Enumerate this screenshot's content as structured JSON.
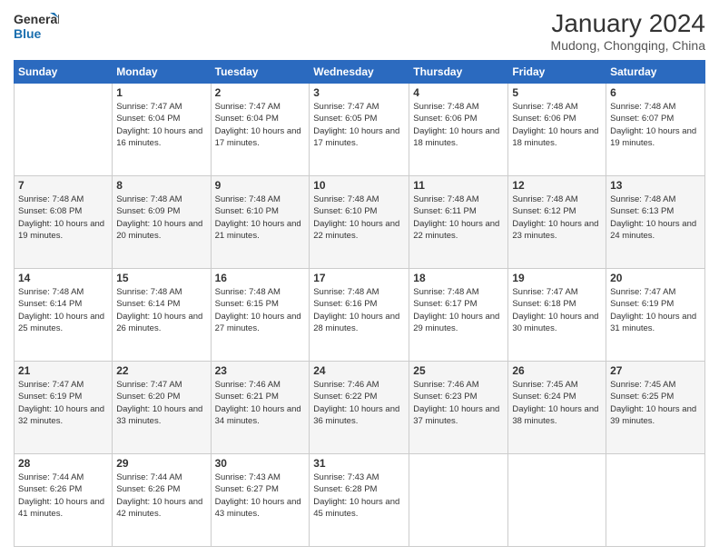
{
  "header": {
    "logo": {
      "line1": "General",
      "line2": "Blue"
    },
    "title": "January 2024",
    "location": "Mudong, Chongqing, China"
  },
  "columns": [
    "Sunday",
    "Monday",
    "Tuesday",
    "Wednesday",
    "Thursday",
    "Friday",
    "Saturday"
  ],
  "weeks": [
    [
      {
        "day": "",
        "sunrise": "",
        "sunset": "",
        "daylight": ""
      },
      {
        "day": "1",
        "sunrise": "Sunrise: 7:47 AM",
        "sunset": "Sunset: 6:04 PM",
        "daylight": "Daylight: 10 hours and 16 minutes."
      },
      {
        "day": "2",
        "sunrise": "Sunrise: 7:47 AM",
        "sunset": "Sunset: 6:04 PM",
        "daylight": "Daylight: 10 hours and 17 minutes."
      },
      {
        "day": "3",
        "sunrise": "Sunrise: 7:47 AM",
        "sunset": "Sunset: 6:05 PM",
        "daylight": "Daylight: 10 hours and 17 minutes."
      },
      {
        "day": "4",
        "sunrise": "Sunrise: 7:48 AM",
        "sunset": "Sunset: 6:06 PM",
        "daylight": "Daylight: 10 hours and 18 minutes."
      },
      {
        "day": "5",
        "sunrise": "Sunrise: 7:48 AM",
        "sunset": "Sunset: 6:06 PM",
        "daylight": "Daylight: 10 hours and 18 minutes."
      },
      {
        "day": "6",
        "sunrise": "Sunrise: 7:48 AM",
        "sunset": "Sunset: 6:07 PM",
        "daylight": "Daylight: 10 hours and 19 minutes."
      }
    ],
    [
      {
        "day": "7",
        "sunrise": "Sunrise: 7:48 AM",
        "sunset": "Sunset: 6:08 PM",
        "daylight": "Daylight: 10 hours and 19 minutes."
      },
      {
        "day": "8",
        "sunrise": "Sunrise: 7:48 AM",
        "sunset": "Sunset: 6:09 PM",
        "daylight": "Daylight: 10 hours and 20 minutes."
      },
      {
        "day": "9",
        "sunrise": "Sunrise: 7:48 AM",
        "sunset": "Sunset: 6:10 PM",
        "daylight": "Daylight: 10 hours and 21 minutes."
      },
      {
        "day": "10",
        "sunrise": "Sunrise: 7:48 AM",
        "sunset": "Sunset: 6:10 PM",
        "daylight": "Daylight: 10 hours and 22 minutes."
      },
      {
        "day": "11",
        "sunrise": "Sunrise: 7:48 AM",
        "sunset": "Sunset: 6:11 PM",
        "daylight": "Daylight: 10 hours and 22 minutes."
      },
      {
        "day": "12",
        "sunrise": "Sunrise: 7:48 AM",
        "sunset": "Sunset: 6:12 PM",
        "daylight": "Daylight: 10 hours and 23 minutes."
      },
      {
        "day": "13",
        "sunrise": "Sunrise: 7:48 AM",
        "sunset": "Sunset: 6:13 PM",
        "daylight": "Daylight: 10 hours and 24 minutes."
      }
    ],
    [
      {
        "day": "14",
        "sunrise": "Sunrise: 7:48 AM",
        "sunset": "Sunset: 6:14 PM",
        "daylight": "Daylight: 10 hours and 25 minutes."
      },
      {
        "day": "15",
        "sunrise": "Sunrise: 7:48 AM",
        "sunset": "Sunset: 6:14 PM",
        "daylight": "Daylight: 10 hours and 26 minutes."
      },
      {
        "day": "16",
        "sunrise": "Sunrise: 7:48 AM",
        "sunset": "Sunset: 6:15 PM",
        "daylight": "Daylight: 10 hours and 27 minutes."
      },
      {
        "day": "17",
        "sunrise": "Sunrise: 7:48 AM",
        "sunset": "Sunset: 6:16 PM",
        "daylight": "Daylight: 10 hours and 28 minutes."
      },
      {
        "day": "18",
        "sunrise": "Sunrise: 7:48 AM",
        "sunset": "Sunset: 6:17 PM",
        "daylight": "Daylight: 10 hours and 29 minutes."
      },
      {
        "day": "19",
        "sunrise": "Sunrise: 7:47 AM",
        "sunset": "Sunset: 6:18 PM",
        "daylight": "Daylight: 10 hours and 30 minutes."
      },
      {
        "day": "20",
        "sunrise": "Sunrise: 7:47 AM",
        "sunset": "Sunset: 6:19 PM",
        "daylight": "Daylight: 10 hours and 31 minutes."
      }
    ],
    [
      {
        "day": "21",
        "sunrise": "Sunrise: 7:47 AM",
        "sunset": "Sunset: 6:19 PM",
        "daylight": "Daylight: 10 hours and 32 minutes."
      },
      {
        "day": "22",
        "sunrise": "Sunrise: 7:47 AM",
        "sunset": "Sunset: 6:20 PM",
        "daylight": "Daylight: 10 hours and 33 minutes."
      },
      {
        "day": "23",
        "sunrise": "Sunrise: 7:46 AM",
        "sunset": "Sunset: 6:21 PM",
        "daylight": "Daylight: 10 hours and 34 minutes."
      },
      {
        "day": "24",
        "sunrise": "Sunrise: 7:46 AM",
        "sunset": "Sunset: 6:22 PM",
        "daylight": "Daylight: 10 hours and 36 minutes."
      },
      {
        "day": "25",
        "sunrise": "Sunrise: 7:46 AM",
        "sunset": "Sunset: 6:23 PM",
        "daylight": "Daylight: 10 hours and 37 minutes."
      },
      {
        "day": "26",
        "sunrise": "Sunrise: 7:45 AM",
        "sunset": "Sunset: 6:24 PM",
        "daylight": "Daylight: 10 hours and 38 minutes."
      },
      {
        "day": "27",
        "sunrise": "Sunrise: 7:45 AM",
        "sunset": "Sunset: 6:25 PM",
        "daylight": "Daylight: 10 hours and 39 minutes."
      }
    ],
    [
      {
        "day": "28",
        "sunrise": "Sunrise: 7:44 AM",
        "sunset": "Sunset: 6:26 PM",
        "daylight": "Daylight: 10 hours and 41 minutes."
      },
      {
        "day": "29",
        "sunrise": "Sunrise: 7:44 AM",
        "sunset": "Sunset: 6:26 PM",
        "daylight": "Daylight: 10 hours and 42 minutes."
      },
      {
        "day": "30",
        "sunrise": "Sunrise: 7:43 AM",
        "sunset": "Sunset: 6:27 PM",
        "daylight": "Daylight: 10 hours and 43 minutes."
      },
      {
        "day": "31",
        "sunrise": "Sunrise: 7:43 AM",
        "sunset": "Sunset: 6:28 PM",
        "daylight": "Daylight: 10 hours and 45 minutes."
      },
      {
        "day": "",
        "sunrise": "",
        "sunset": "",
        "daylight": ""
      },
      {
        "day": "",
        "sunrise": "",
        "sunset": "",
        "daylight": ""
      },
      {
        "day": "",
        "sunrise": "",
        "sunset": "",
        "daylight": ""
      }
    ]
  ]
}
